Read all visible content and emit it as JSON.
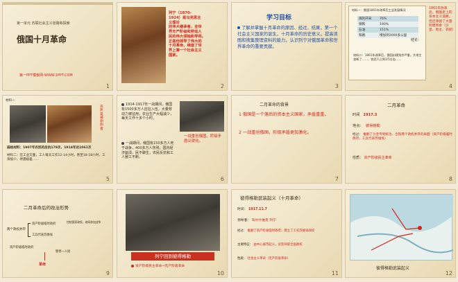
{
  "slides": [
    {
      "number": "1",
      "unit": "第一单元  苏联社会主义道路和探索",
      "title": "俄国十月革命",
      "footer": "第一PPT模板网-WWW.1PPT.COM"
    },
    {
      "number": "2",
      "caption_lines": [
        "列宁（1870-",
        "1924）是马克思主",
        "义理论",
        "的伟大继承者，全世",
        "界无产阶级和劳动人",
        "民的伟大领袖和导师。",
        "正是他领导了伟大的",
        "十月革命，缔造了世",
        "界上第一个社会主义",
        "国家。"
      ]
    },
    {
      "number": "3",
      "heading": "学习目标",
      "body": "了解并掌握十月革命的原因、经过、结果，第一个社会主义国家的诞生，十月革命的历史意义。提高读图和搜集整理资料的能力，认识列宁对俄国革命和世界革命的重要贡献。"
    },
    {
      "number": "4",
      "material_title": "材料一：俄国1861年改革后工业发展情况",
      "table": [
        [
          "煤的开采",
          "76%"
        ],
        [
          "钢铁",
          "190%"
        ],
        [
          "石油",
          "151%"
        ],
        [
          "铁路",
          "增加到3000多公里"
        ]
      ],
      "note": "材料二：1861年改革后，俄国封建残余严重，大地主垄断了……，农民只占到1/5左右……",
      "side_text": "1861年改革后，俄国走上的资本主义道路，但还保留了大量封建残余（沙皇、地主、农奴）",
      "label": "结论："
    },
    {
      "number": "5",
      "material": "材料一",
      "side": "农民是被剥削者",
      "caption1": "描绘材料：1907年农民的反抗179次，1914年达1061次",
      "caption2": "材料二：在工业方面，工人每天工作12-14小时，甚至18-18小时，工资极少，待遇极差……"
    },
    {
      "number": "6",
      "bullets": [
        "1914-1917年一战期间，俄国有1500多万人应征入伍，大量劳动力被征用，农业生产大幅减少，每天工作十多个小时。",
        "一战期间，俄国有150多万人死于战争，400多万人伤残，国内经济崩溃，民不聊生，农民反抗和工人罢工不断。"
      ],
      "right_note": "一战重创俄国，阶级矛盾尖锐化。"
    },
    {
      "number": "7",
      "heading": "二月革命的背景",
      "items": [
        "1  俄国是一个落后的资本主义国家，矛盾重重。",
        "2  一战重创俄国，阶级矛盾更加激化。"
      ]
    },
    {
      "number": "8",
      "heading": "二月革命",
      "time_label": "时间",
      "time_value": "1917.3",
      "place_label": "地点：",
      "place_value": "彼得格勒",
      "process_label": "经过：",
      "process_value": "推翻了沙皇专制统治，出现两个政权并存的局面（资产阶级临时政府，工兵代表苏维埃）",
      "nature_label": "性质：",
      "nature_value": "资产阶级民主革命"
    },
    {
      "number": "9",
      "heading": "二月革命后的政治形势",
      "left_label": "两个政权并存",
      "item1": "资产阶级临时政府",
      "item1_note": "控制国家政权，继续参加战争",
      "item2": "工兵代表苏维埃",
      "bottom_item": "资产阶级临时政府",
      "bottom_note": "暂停一人民",
      "result": "革命"
    },
    {
      "number": "10",
      "heading": "列宁回到彼得格勒",
      "caption": "资产阶级民主革命→无产阶级革命"
    },
    {
      "number": "11",
      "heading": "彼得格勒武装起义（十月革命）",
      "time_label": "时间：",
      "time_value": "1917.11.7",
      "leader_label": "领导者：",
      "leader_value": "布尔什维克  列宁",
      "process_label": "经过：",
      "process_value": "推翻了资产阶级临时政府，建立了工农苏维埃政权",
      "note_label": "主要特征：",
      "note_value": "由中心城市起义，武装夺取全国政权",
      "nature_label": "性质：",
      "nature_value": "社会主义革命（无产阶级革命）"
    },
    {
      "number": "12",
      "heading": "彼得格勒武装起义"
    }
  ],
  "colors": {
    "accent_red": "#d4251c",
    "bg": "#f2ead6"
  }
}
